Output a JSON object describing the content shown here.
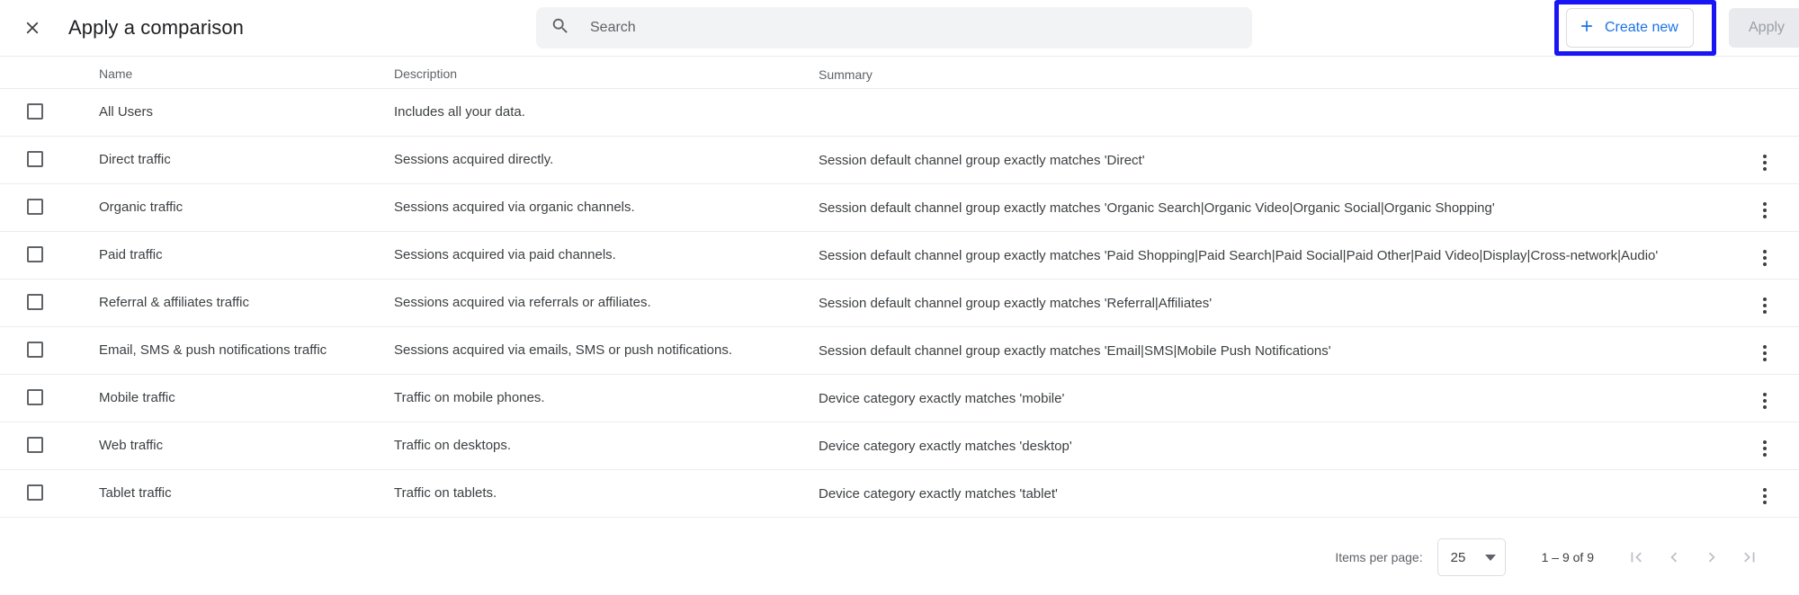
{
  "header": {
    "close_icon": "close-icon",
    "title": "Apply a comparison",
    "search": {
      "icon": "search-icon",
      "placeholder": "Search",
      "value": ""
    },
    "create_new_label": "Create new",
    "create_new_icon": "plus-icon",
    "apply_label": "Apply",
    "annotation_color": "#1a15f5",
    "accent_color": "#1a73e8"
  },
  "table": {
    "columns": [
      "Name",
      "Description",
      "Summary"
    ],
    "rows": [
      {
        "checked": false,
        "name": "All Users",
        "description": "Includes all your data.",
        "summary": "",
        "has_menu": false
      },
      {
        "checked": false,
        "name": "Direct traffic",
        "description": "Sessions acquired directly.",
        "summary": "Session default channel group exactly matches 'Direct'",
        "has_menu": true
      },
      {
        "checked": false,
        "name": "Organic traffic",
        "description": "Sessions acquired via organic channels.",
        "summary": "Session default channel group exactly matches 'Organic Search|Organic Video|Organic Social|Organic Shopping'",
        "has_menu": true
      },
      {
        "checked": false,
        "name": "Paid traffic",
        "description": "Sessions acquired via paid channels.",
        "summary": "Session default channel group exactly matches 'Paid Shopping|Paid Search|Paid Social|Paid Other|Paid Video|Display|Cross-network|Audio'",
        "has_menu": true
      },
      {
        "checked": false,
        "name": "Referral & affiliates traffic",
        "description": "Sessions acquired via referrals or affiliates.",
        "summary": "Session default channel group exactly matches 'Referral|Affiliates'",
        "has_menu": true
      },
      {
        "checked": false,
        "name": "Email, SMS & push notifications traffic",
        "description": "Sessions acquired via emails, SMS or push notifications.",
        "summary": "Session default channel group exactly matches 'Email|SMS|Mobile Push Notifications'",
        "has_menu": true
      },
      {
        "checked": false,
        "name": "Mobile traffic",
        "description": "Traffic on mobile phones.",
        "summary": "Device category exactly matches 'mobile'",
        "has_menu": true
      },
      {
        "checked": false,
        "name": "Web traffic",
        "description": "Traffic on desktops.",
        "summary": "Device category exactly matches 'desktop'",
        "has_menu": true
      },
      {
        "checked": false,
        "name": "Tablet traffic",
        "description": "Traffic on tablets.",
        "summary": "Device category exactly matches 'tablet'",
        "has_menu": true
      }
    ]
  },
  "paginator": {
    "items_per_page_label": "Items per page:",
    "items_per_page_value": "25",
    "range_label": "1 – 9 of 9",
    "first_page_icon": "first-page-icon",
    "prev_page_icon": "chevron-left-icon",
    "next_page_icon": "chevron-right-icon",
    "last_page_icon": "last-page-icon"
  }
}
